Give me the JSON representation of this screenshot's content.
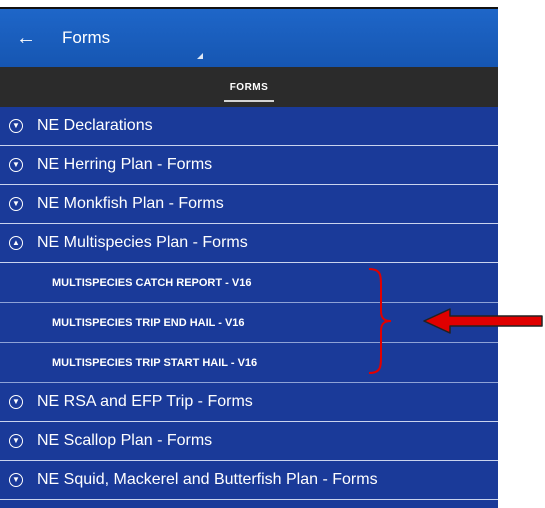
{
  "appbar": {
    "back_icon": "arrow-left-icon",
    "title": "Forms"
  },
  "tabs": [
    {
      "label": "FORMS",
      "active": true
    }
  ],
  "groups_top": [
    {
      "label": "NE Declarations",
      "expanded": false
    },
    {
      "label": "NE Herring Plan - Forms",
      "expanded": false
    },
    {
      "label": "NE Monkfish Plan - Forms",
      "expanded": false
    },
    {
      "label": "NE Multispecies Plan - Forms",
      "expanded": true
    }
  ],
  "multispecies_forms": [
    {
      "label": "MULTISPECIES CATCH REPORT - V16"
    },
    {
      "label": "MULTISPECIES TRIP END HAIL - V16"
    },
    {
      "label": "MULTISPECIES TRIP START HAIL - V16"
    }
  ],
  "groups_bottom": [
    {
      "label": "NE RSA and EFP Trip - Forms",
      "expanded": false
    },
    {
      "label": "NE Scallop Plan - Forms",
      "expanded": false
    },
    {
      "label": "NE Squid, Mackerel and Butterfish Plan - Forms",
      "expanded": false
    }
  ],
  "colors": {
    "list_bg": "#1a3a99",
    "appbar": "#1e66c8",
    "tabbar": "#2b2b2b",
    "annotation": "#e00000"
  }
}
